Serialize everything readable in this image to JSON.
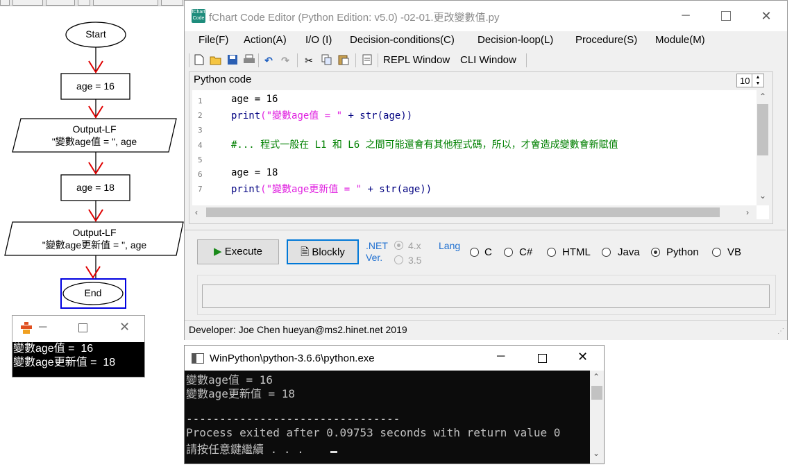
{
  "flowchart": {
    "start": "Start",
    "step1": "age = 16",
    "output1_line1": "Output-LF",
    "output1_line2": "\"變數age值 = \", age",
    "step2": "age = 18",
    "output2_line1": "Output-LF",
    "output2_line2": "\"變數age更新值 = \", age",
    "end": "End"
  },
  "small_console": {
    "lines": [
      "變數age值 =  16",
      "變數age更新值 =  18"
    ]
  },
  "editor": {
    "title": "fChart Code Editor (Python Edition:  v5.0) -02-01.更改變數值.py",
    "icon_text": "fChart Code",
    "menu": [
      "File(F)",
      "Action(A)",
      "I/O (I)",
      "Decision-conditions(C)",
      "Decision-loop(L)",
      "Procedure(S)",
      "Module(M)"
    ],
    "toolbar": {
      "repl": "REPL Window",
      "cli": "CLI Window",
      "icons": [
        "new-file-icon",
        "open-folder-icon",
        "save-icon",
        "print-icon",
        "undo-icon",
        "redo-icon",
        "cut-icon",
        "copy-icon",
        "paste-icon",
        "print-preview-icon"
      ]
    },
    "code_label": "Python code",
    "font_size": "10",
    "line_numbers": [
      "1",
      "2",
      "3",
      "4",
      "5",
      "6",
      "7"
    ],
    "code": {
      "l1_a": "age = 16",
      "l2_kw": "print",
      "l2_str": "(\"變數age值 = \"",
      "l2_rest": " + str(age))",
      "l4": "#... 程式一般在 L1 和 L6 之間可能還會有其他程式碼，所以，才會造成變數會新賦值",
      "l6_a": "age = 18",
      "l7_kw": "print",
      "l7_str": "(\"變數age更新值 = \"",
      "l7_rest": " + str(age))"
    },
    "execute": "Execute",
    "blockly": "Blockly",
    "net_label": ".NET",
    "ver_label": "Ver.",
    "net_opt1": "4.x",
    "net_opt2": "3.5",
    "lang_label": "Lang",
    "langs": [
      "C",
      "C#",
      "HTML",
      "Java",
      "Python",
      "VB"
    ],
    "selected_lang": "Python",
    "status": "Developer: Joe Chen hueyan@ms2.hinet.net 2019"
  },
  "python_console": {
    "title": "WinPython\\python-3.6.6\\python.exe",
    "lines": [
      "變數age值 = 16",
      "變數age更新值 = 18",
      "",
      "--------------------------------",
      "Process exited after 0.09753 seconds with return value 0",
      "請按任意鍵繼續 . . . "
    ]
  }
}
